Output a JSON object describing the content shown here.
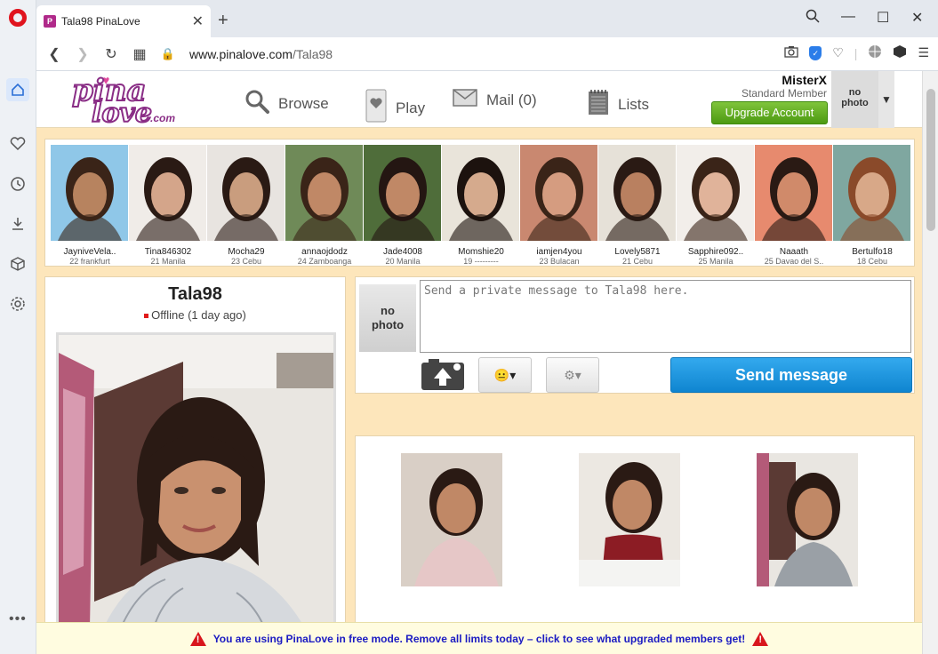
{
  "browser": {
    "tab_title": "Tala98 PinaLove",
    "url_host": "www.pinalove.com",
    "url_path": "/Tala98"
  },
  "site": {
    "logo": {
      "line1": "pina",
      "line2": "love",
      "suffix": ".com"
    },
    "nav": {
      "browse": "Browse",
      "play": "Play",
      "mail": "Mail (0)",
      "lists": "Lists"
    },
    "user": {
      "name": "MisterX",
      "tier": "Standard Member",
      "upgrade_label": "Upgrade Account",
      "no_photo": "no\nphoto"
    },
    "members": [
      {
        "name": "JayniveVela..",
        "loc": "22 frankfurt"
      },
      {
        "name": "Tina846302",
        "loc": "21 Manila"
      },
      {
        "name": "Mocha29",
        "loc": "23 Cebu"
      },
      {
        "name": "annaojdodz",
        "loc": "24 Zamboanga"
      },
      {
        "name": "Jade4008",
        "loc": "20 Manila"
      },
      {
        "name": "Momshie20",
        "loc": "19 ---------"
      },
      {
        "name": "iamjen4you",
        "loc": "23 Bulacan"
      },
      {
        "name": "Lovely5871",
        "loc": "21 Cebu"
      },
      {
        "name": "Sapphire092..",
        "loc": "25 Manila"
      },
      {
        "name": "Naaath",
        "loc": "25 Davao del S.."
      },
      {
        "name": "Bertulfo18",
        "loc": "18 Cebu"
      }
    ],
    "profile": {
      "username": "Tala98",
      "status": "Offline (1 day ago)"
    },
    "message": {
      "no_photo_1": "no",
      "no_photo_2": "photo",
      "placeholder": "Send a private message to Tala98 here.",
      "send_label": "Send message",
      "emoji_label": "😐▾",
      "settings_label": "⚙▾"
    },
    "banner": "You are using PinaLove in free mode. Remove all limits today – click to see what upgraded members get!"
  },
  "colors": {
    "page_bg": "#fde6bb",
    "brand_purple": "#8a2e86",
    "upgrade_green": "#5aa81d",
    "send_blue": "#1a95dc",
    "banner_text": "#1b1bc2"
  }
}
